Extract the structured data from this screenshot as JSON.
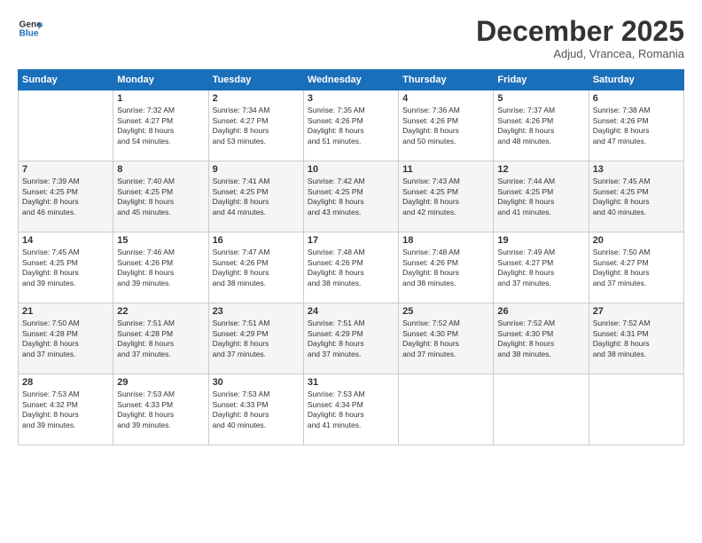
{
  "header": {
    "logo_line1": "General",
    "logo_line2": "Blue",
    "month": "December 2025",
    "location": "Adjud, Vrancea, Romania"
  },
  "weekdays": [
    "Sunday",
    "Monday",
    "Tuesday",
    "Wednesday",
    "Thursday",
    "Friday",
    "Saturday"
  ],
  "weeks": [
    [
      {
        "day": "",
        "info": ""
      },
      {
        "day": "1",
        "info": "Sunrise: 7:32 AM\nSunset: 4:27 PM\nDaylight: 8 hours\nand 54 minutes."
      },
      {
        "day": "2",
        "info": "Sunrise: 7:34 AM\nSunset: 4:27 PM\nDaylight: 8 hours\nand 53 minutes."
      },
      {
        "day": "3",
        "info": "Sunrise: 7:35 AM\nSunset: 4:26 PM\nDaylight: 8 hours\nand 51 minutes."
      },
      {
        "day": "4",
        "info": "Sunrise: 7:36 AM\nSunset: 4:26 PM\nDaylight: 8 hours\nand 50 minutes."
      },
      {
        "day": "5",
        "info": "Sunrise: 7:37 AM\nSunset: 4:26 PM\nDaylight: 8 hours\nand 48 minutes."
      },
      {
        "day": "6",
        "info": "Sunrise: 7:38 AM\nSunset: 4:26 PM\nDaylight: 8 hours\nand 47 minutes."
      }
    ],
    [
      {
        "day": "7",
        "info": "Sunrise: 7:39 AM\nSunset: 4:25 PM\nDaylight: 8 hours\nand 46 minutes."
      },
      {
        "day": "8",
        "info": "Sunrise: 7:40 AM\nSunset: 4:25 PM\nDaylight: 8 hours\nand 45 minutes."
      },
      {
        "day": "9",
        "info": "Sunrise: 7:41 AM\nSunset: 4:25 PM\nDaylight: 8 hours\nand 44 minutes."
      },
      {
        "day": "10",
        "info": "Sunrise: 7:42 AM\nSunset: 4:25 PM\nDaylight: 8 hours\nand 43 minutes."
      },
      {
        "day": "11",
        "info": "Sunrise: 7:43 AM\nSunset: 4:25 PM\nDaylight: 8 hours\nand 42 minutes."
      },
      {
        "day": "12",
        "info": "Sunrise: 7:44 AM\nSunset: 4:25 PM\nDaylight: 8 hours\nand 41 minutes."
      },
      {
        "day": "13",
        "info": "Sunrise: 7:45 AM\nSunset: 4:25 PM\nDaylight: 8 hours\nand 40 minutes."
      }
    ],
    [
      {
        "day": "14",
        "info": "Sunrise: 7:45 AM\nSunset: 4:25 PM\nDaylight: 8 hours\nand 39 minutes."
      },
      {
        "day": "15",
        "info": "Sunrise: 7:46 AM\nSunset: 4:26 PM\nDaylight: 8 hours\nand 39 minutes."
      },
      {
        "day": "16",
        "info": "Sunrise: 7:47 AM\nSunset: 4:26 PM\nDaylight: 8 hours\nand 38 minutes."
      },
      {
        "day": "17",
        "info": "Sunrise: 7:48 AM\nSunset: 4:26 PM\nDaylight: 8 hours\nand 38 minutes."
      },
      {
        "day": "18",
        "info": "Sunrise: 7:48 AM\nSunset: 4:26 PM\nDaylight: 8 hours\nand 38 minutes."
      },
      {
        "day": "19",
        "info": "Sunrise: 7:49 AM\nSunset: 4:27 PM\nDaylight: 8 hours\nand 37 minutes."
      },
      {
        "day": "20",
        "info": "Sunrise: 7:50 AM\nSunset: 4:27 PM\nDaylight: 8 hours\nand 37 minutes."
      }
    ],
    [
      {
        "day": "21",
        "info": "Sunrise: 7:50 AM\nSunset: 4:28 PM\nDaylight: 8 hours\nand 37 minutes."
      },
      {
        "day": "22",
        "info": "Sunrise: 7:51 AM\nSunset: 4:28 PM\nDaylight: 8 hours\nand 37 minutes."
      },
      {
        "day": "23",
        "info": "Sunrise: 7:51 AM\nSunset: 4:29 PM\nDaylight: 8 hours\nand 37 minutes."
      },
      {
        "day": "24",
        "info": "Sunrise: 7:51 AM\nSunset: 4:29 PM\nDaylight: 8 hours\nand 37 minutes."
      },
      {
        "day": "25",
        "info": "Sunrise: 7:52 AM\nSunset: 4:30 PM\nDaylight: 8 hours\nand 37 minutes."
      },
      {
        "day": "26",
        "info": "Sunrise: 7:52 AM\nSunset: 4:30 PM\nDaylight: 8 hours\nand 38 minutes."
      },
      {
        "day": "27",
        "info": "Sunrise: 7:52 AM\nSunset: 4:31 PM\nDaylight: 8 hours\nand 38 minutes."
      }
    ],
    [
      {
        "day": "28",
        "info": "Sunrise: 7:53 AM\nSunset: 4:32 PM\nDaylight: 8 hours\nand 39 minutes."
      },
      {
        "day": "29",
        "info": "Sunrise: 7:53 AM\nSunset: 4:33 PM\nDaylight: 8 hours\nand 39 minutes."
      },
      {
        "day": "30",
        "info": "Sunrise: 7:53 AM\nSunset: 4:33 PM\nDaylight: 8 hours\nand 40 minutes."
      },
      {
        "day": "31",
        "info": "Sunrise: 7:53 AM\nSunset: 4:34 PM\nDaylight: 8 hours\nand 41 minutes."
      },
      {
        "day": "",
        "info": ""
      },
      {
        "day": "",
        "info": ""
      },
      {
        "day": "",
        "info": ""
      }
    ]
  ]
}
